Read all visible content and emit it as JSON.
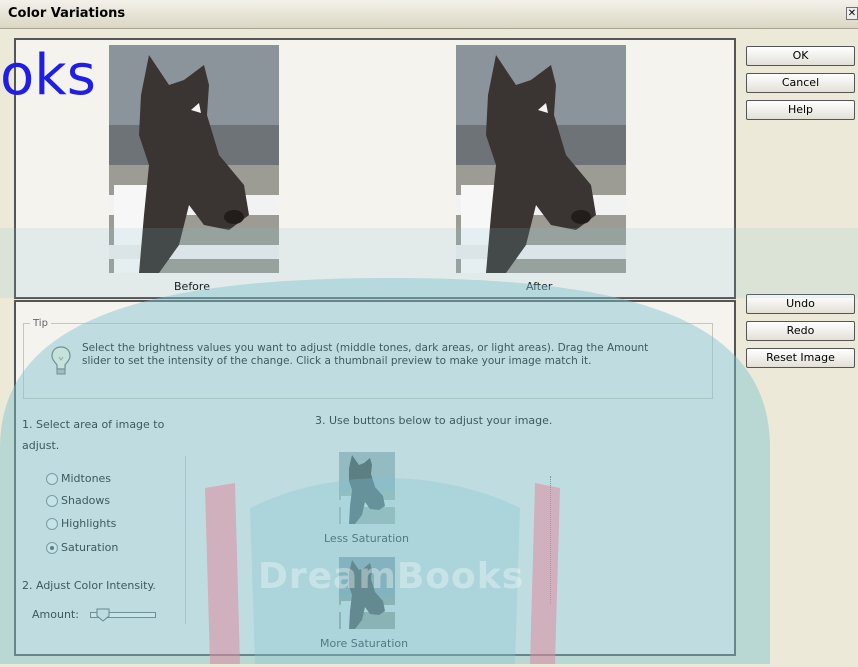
{
  "window": {
    "title": "Color Variations",
    "close_glyph": "✕"
  },
  "watermark": {
    "top_text": "oks",
    "center_text": "DreamBooks"
  },
  "preview": {
    "before_label": "Before",
    "after_label": "After"
  },
  "buttons": {
    "ok": "OK",
    "cancel": "Cancel",
    "help": "Help",
    "undo": "Undo",
    "redo": "Redo",
    "reset": "Reset Image"
  },
  "tip": {
    "legend": "Tip",
    "icon": "lightbulb-icon",
    "text": "Select the brightness values you want to adjust (middle tones, dark areas, or light areas). Drag the Amount slider to set the intensity of the change. Click a thumbnail preview to make your image match it."
  },
  "step1": {
    "label": "1. Select area of image to adjust."
  },
  "areas": [
    {
      "label": "Midtones",
      "selected": false
    },
    {
      "label": "Shadows",
      "selected": false
    },
    {
      "label": "Highlights",
      "selected": false
    },
    {
      "label": "Saturation",
      "selected": true
    }
  ],
  "step2": {
    "label": "2. Adjust Color Intensity.",
    "amount_label": "Amount:"
  },
  "step3": {
    "label": "3. Use buttons below to adjust your image."
  },
  "adjust": {
    "less_label": "Less Saturation",
    "more_label": "More Saturation"
  },
  "colors": {
    "watermark_blue": "#1e1ee6",
    "overlay_teal": "#7fc4cf",
    "frame": "#555555",
    "panel_bg": "#f4f3ee"
  }
}
